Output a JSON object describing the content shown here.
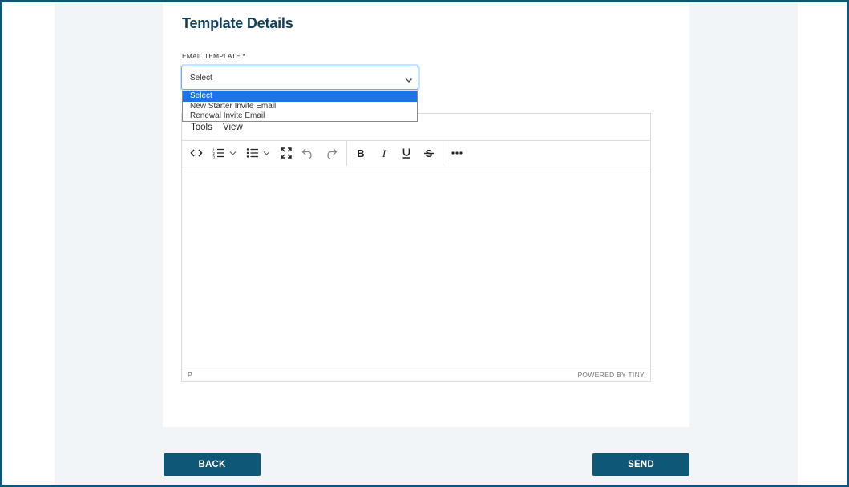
{
  "section": {
    "title": "Template Details"
  },
  "email_template": {
    "label": "EMAIL TEMPLATE *",
    "selected": "Select",
    "options": [
      "Select",
      "New Starter Invite Email",
      "Renewal Invite Email"
    ]
  },
  "editor": {
    "menu": [
      "Tools",
      "View"
    ],
    "toolbar": [
      "source-code-icon",
      "numbered-list-icon",
      "dropdown-chevron-icon",
      "bullet-list-icon",
      "dropdown-chevron-icon",
      "fullscreen-icon",
      "undo-icon",
      "redo-icon",
      "bold-icon",
      "italic-icon",
      "underline-icon",
      "strikethrough-icon",
      "more-icon"
    ],
    "status_path": "P",
    "branding": "POWERED BY TINY"
  },
  "actions": {
    "back_label": "BACK",
    "send_label": "SEND"
  },
  "colors": {
    "primary": "#0e5777",
    "title": "#123f5c",
    "selection": "#1e73e8",
    "page_bg": "#f2f5f7"
  }
}
